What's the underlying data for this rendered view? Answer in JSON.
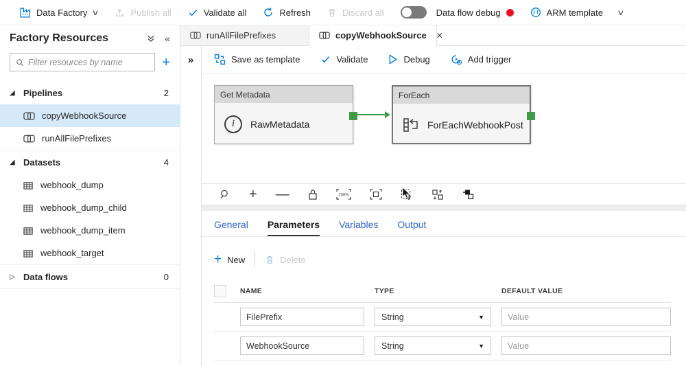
{
  "palette": {
    "accent": "#0078d4",
    "link": "#3465c8",
    "red": "#e81123",
    "green": "#3f9b45",
    "selbg": "#d5e9f9"
  },
  "top_toolbar": {
    "data_factory": "Data Factory",
    "publish_all": "Publish all",
    "validate_all": "Validate all",
    "refresh": "Refresh",
    "discard_all": "Discard all",
    "data_flow_debug": "Data flow debug",
    "toggle_state": "off",
    "arm_template": "ARM template"
  },
  "sidebar": {
    "title": "Factory Resources",
    "filter_placeholder": "Filter resources by name",
    "sections": [
      {
        "label": "Pipelines",
        "count": "2",
        "expanded": true,
        "items": [
          "copyWebhookSource",
          "runAllFilePrefixes"
        ]
      },
      {
        "label": "Datasets",
        "count": "4",
        "expanded": true,
        "items": [
          "webhook_dump",
          "webhook_dump_child",
          "webhook_dump_item",
          "webhook_target"
        ]
      },
      {
        "label": "Data flows",
        "count": "0",
        "expanded": false,
        "items": []
      }
    ]
  },
  "tabs": [
    {
      "label": "runAllFilePrefixes",
      "active": false
    },
    {
      "label": "copyWebhookSource",
      "active": true
    }
  ],
  "pipeline_toolbar": {
    "save_as_template": "Save as template",
    "validate": "Validate",
    "debug": "Debug",
    "add_trigger": "Add trigger"
  },
  "canvas": {
    "nodes": [
      {
        "type": "Get Metadata",
        "name": "RawMetadata"
      },
      {
        "type": "ForEach",
        "name": "ForEachWebhookPost"
      }
    ],
    "zoom_reset_label": "100%"
  },
  "bottom_panel": {
    "tabs": [
      "General",
      "Parameters",
      "Variables",
      "Output"
    ],
    "active_tab": "Parameters",
    "actions": {
      "new": "New",
      "delete": "Delete"
    },
    "table": {
      "headers": [
        "NAME",
        "TYPE",
        "DEFAULT VALUE"
      ],
      "rows": [
        {
          "name": "FilePrefix",
          "type": "String",
          "default_placeholder": "Value"
        },
        {
          "name": "WebhookSource",
          "type": "String",
          "default_placeholder": "Value"
        }
      ]
    }
  }
}
